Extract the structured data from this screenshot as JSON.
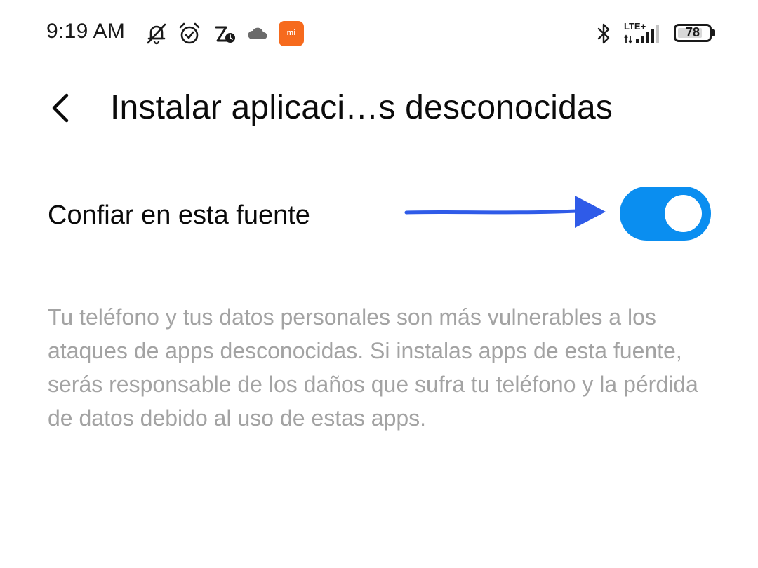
{
  "status_bar": {
    "time": "9:19 AM",
    "icons": [
      "notifications-muted-icon",
      "alarm-icon",
      "auto-timer-icon",
      "cloud-icon",
      "mi-app-icon",
      "bluetooth-icon",
      "signal-icon",
      "battery-icon"
    ],
    "mi_badge": "mi",
    "network_type": "LTE+",
    "battery_level": "78"
  },
  "header": {
    "title": "Instalar aplicaci…s desconocidas"
  },
  "setting": {
    "label": "Confiar en esta fuente",
    "toggle_on": true,
    "toggle_color": "#0a8ef0"
  },
  "annotation": {
    "arrow_color": "#2f5be8"
  },
  "description": {
    "text": "Tu teléfono y tus datos personales son más vulnerables a los ataques de apps desconocidas. Si instalas apps de esta fuente, serás responsable de los daños que sufra tu teléfono y la pérdida de datos debido al uso de estas apps."
  }
}
